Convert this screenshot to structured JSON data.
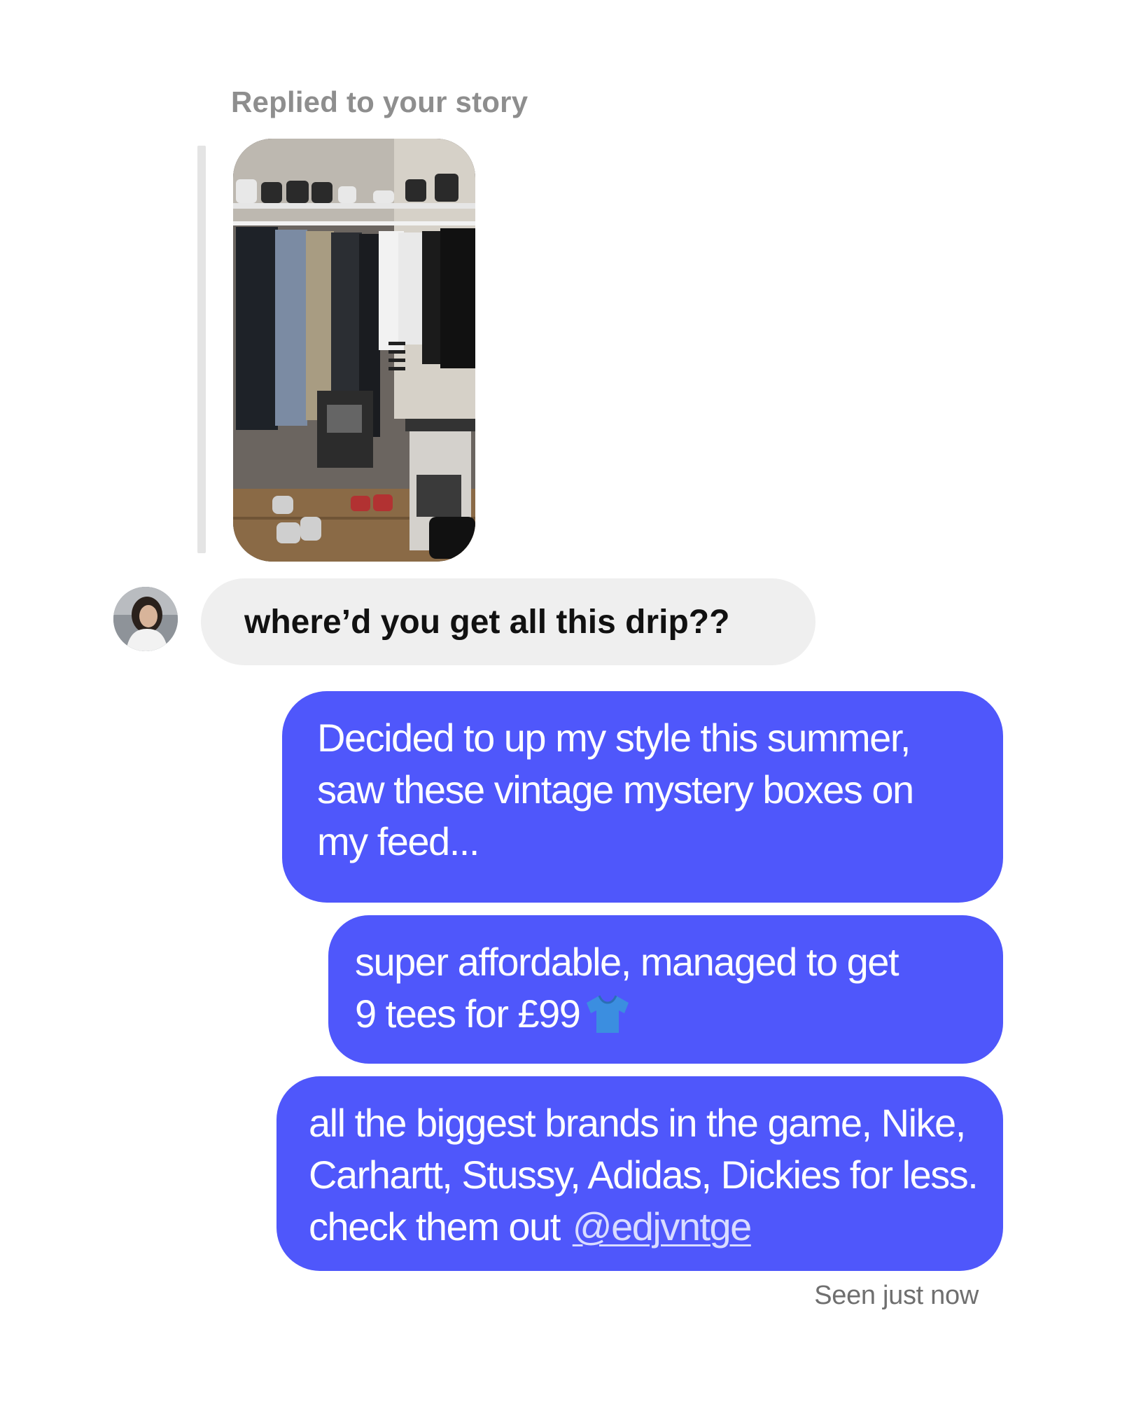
{
  "story_reply": {
    "label": "Replied to your story",
    "thumbnail_description": "story-photo"
  },
  "incoming_message": {
    "text": "where’d you get all this drip??",
    "avatar_icon": "profile-avatar"
  },
  "outgoing_messages": [
    {
      "lines": [
        "Decided to up my style this summer,",
        "saw these vintage mystery boxes on",
        "my feed..."
      ]
    },
    {
      "lines": [
        "super affordable, managed to get",
        "9 tees for £99"
      ],
      "emoji_icon": "t-shirt-icon"
    },
    {
      "lines": [
        "all the biggest brands in the game, Nike,",
        "Carhartt, Stussy, Adidas, Dickies for less.",
        "check them out"
      ],
      "mention": "@edjvntge"
    }
  ],
  "status": {
    "seen_text": "Seen just now"
  },
  "colors": {
    "outgoing_bubble": "#4f57fb",
    "incoming_bubble": "#efefef",
    "label_gray": "#8e8e8e",
    "reply_bar": "#e4e4e4"
  }
}
